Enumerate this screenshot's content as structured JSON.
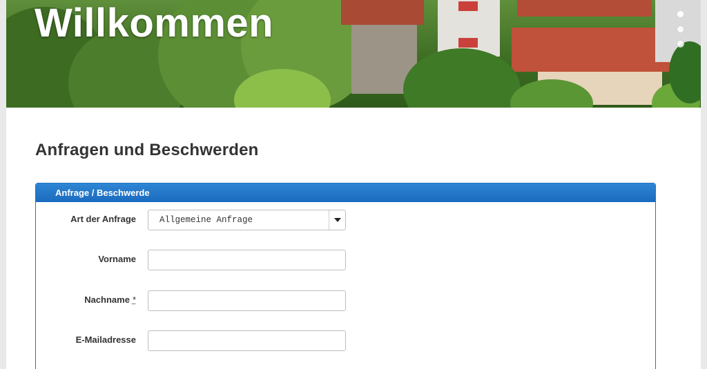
{
  "hero": {
    "title": "Willkommen",
    "slides": 3,
    "active_slide": 1
  },
  "page": {
    "heading": "Anfragen und Beschwerden"
  },
  "form": {
    "panel_title": "Anfrage / Beschwerde",
    "fields": {
      "type": {
        "label": "Art der Anfrage",
        "value": "Allgemeine Anfrage"
      },
      "first_name": {
        "label": "Vorname",
        "value": ""
      },
      "last_name": {
        "label": "Nachname",
        "required_mark": "*",
        "value": ""
      },
      "email": {
        "label": "E-Mailadresse",
        "value": ""
      }
    }
  },
  "colors": {
    "panel_header": "#1a6bbf",
    "panel_border": "#1f73c3",
    "heading_text": "#333333",
    "page_background": "#e9e9e9"
  }
}
